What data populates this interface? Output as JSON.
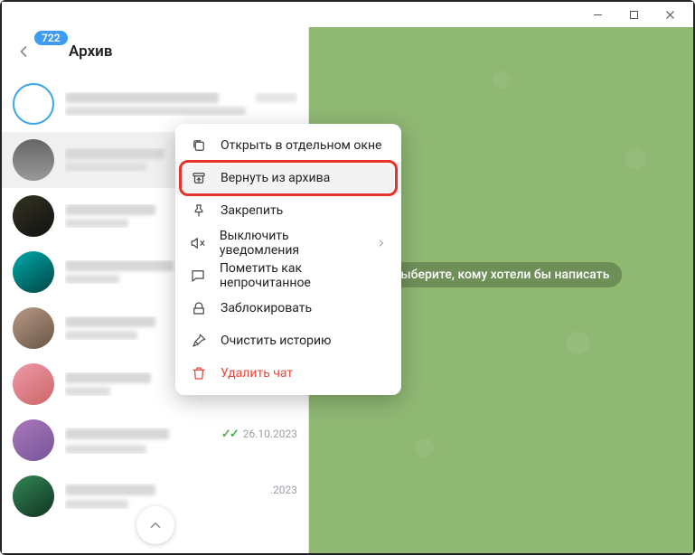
{
  "window": {
    "minimize": "—",
    "maximize": "□",
    "close": "×"
  },
  "header": {
    "back_icon": "←",
    "badge_count": "722",
    "title": "Архив"
  },
  "chats": [
    {
      "avatar": "ring"
    },
    {
      "avatar": "a1",
      "selected": true
    },
    {
      "avatar": "a2"
    },
    {
      "avatar": "a3"
    },
    {
      "avatar": "a4"
    },
    {
      "avatar": "a5"
    },
    {
      "avatar": "a6",
      "checks": "✓✓",
      "date": "26.10.2023"
    },
    {
      "avatar": "a7",
      "date_partial": ".2023"
    }
  ],
  "context_menu": {
    "open_separate": "Открыть в отдельном окне",
    "unarchive": "Вернуть из архива",
    "pin": "Закрепить",
    "mute": "Выключить уведомления",
    "mark_unread": "Пометить как непрочитанное",
    "block": "Заблокировать",
    "clear_history": "Очистить историю",
    "delete": "Удалить чат"
  },
  "main": {
    "placeholder": "Выберите, кому хотели бы написать"
  }
}
